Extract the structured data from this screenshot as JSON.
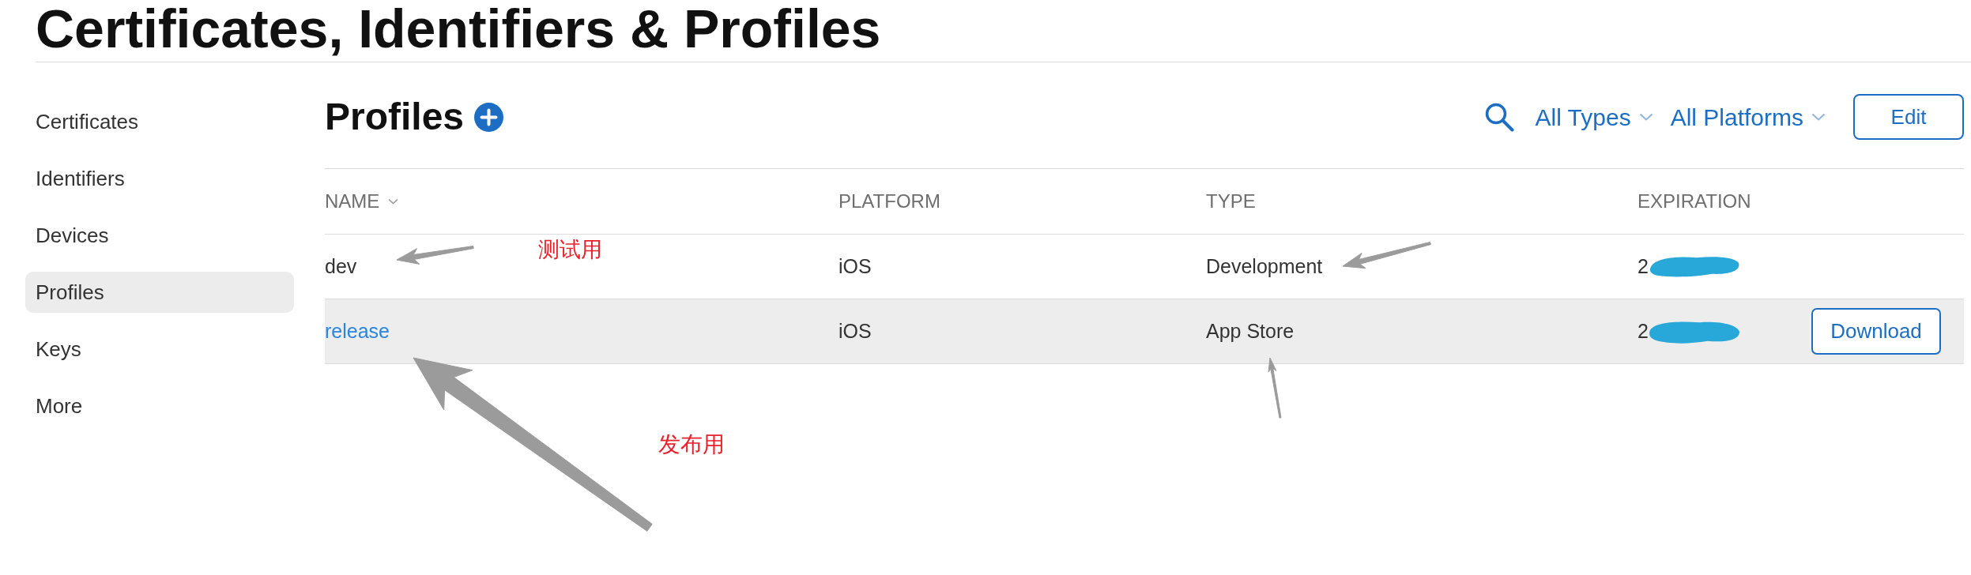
{
  "page_title": "Certificates, Identifiers & Profiles",
  "sidebar": {
    "items": [
      {
        "label": "Certificates",
        "selected": false
      },
      {
        "label": "Identifiers",
        "selected": false
      },
      {
        "label": "Devices",
        "selected": false
      },
      {
        "label": "Profiles",
        "selected": true
      },
      {
        "label": "Keys",
        "selected": false
      },
      {
        "label": "More",
        "selected": false
      }
    ]
  },
  "toolbar": {
    "title": "Profiles",
    "filters": [
      {
        "label": "All Types"
      },
      {
        "label": "All Platforms"
      }
    ],
    "edit_button": "Edit"
  },
  "table": {
    "columns": [
      {
        "label": "NAME",
        "sorted": true
      },
      {
        "label": "PLATFORM",
        "sorted": false
      },
      {
        "label": "TYPE",
        "sorted": false
      },
      {
        "label": "EXPIRATION",
        "sorted": false
      }
    ],
    "rows": [
      {
        "name": "dev",
        "platform": "iOS",
        "type": "Development",
        "expiration": "2",
        "redacted": true,
        "selected": false
      },
      {
        "name": "release",
        "platform": "iOS",
        "type": "App Store",
        "expiration": "2",
        "redacted": true,
        "selected": true,
        "action": "Download"
      }
    ]
  },
  "annotations": [
    {
      "text": "测试用"
    },
    {
      "text": "发布用"
    }
  ]
}
